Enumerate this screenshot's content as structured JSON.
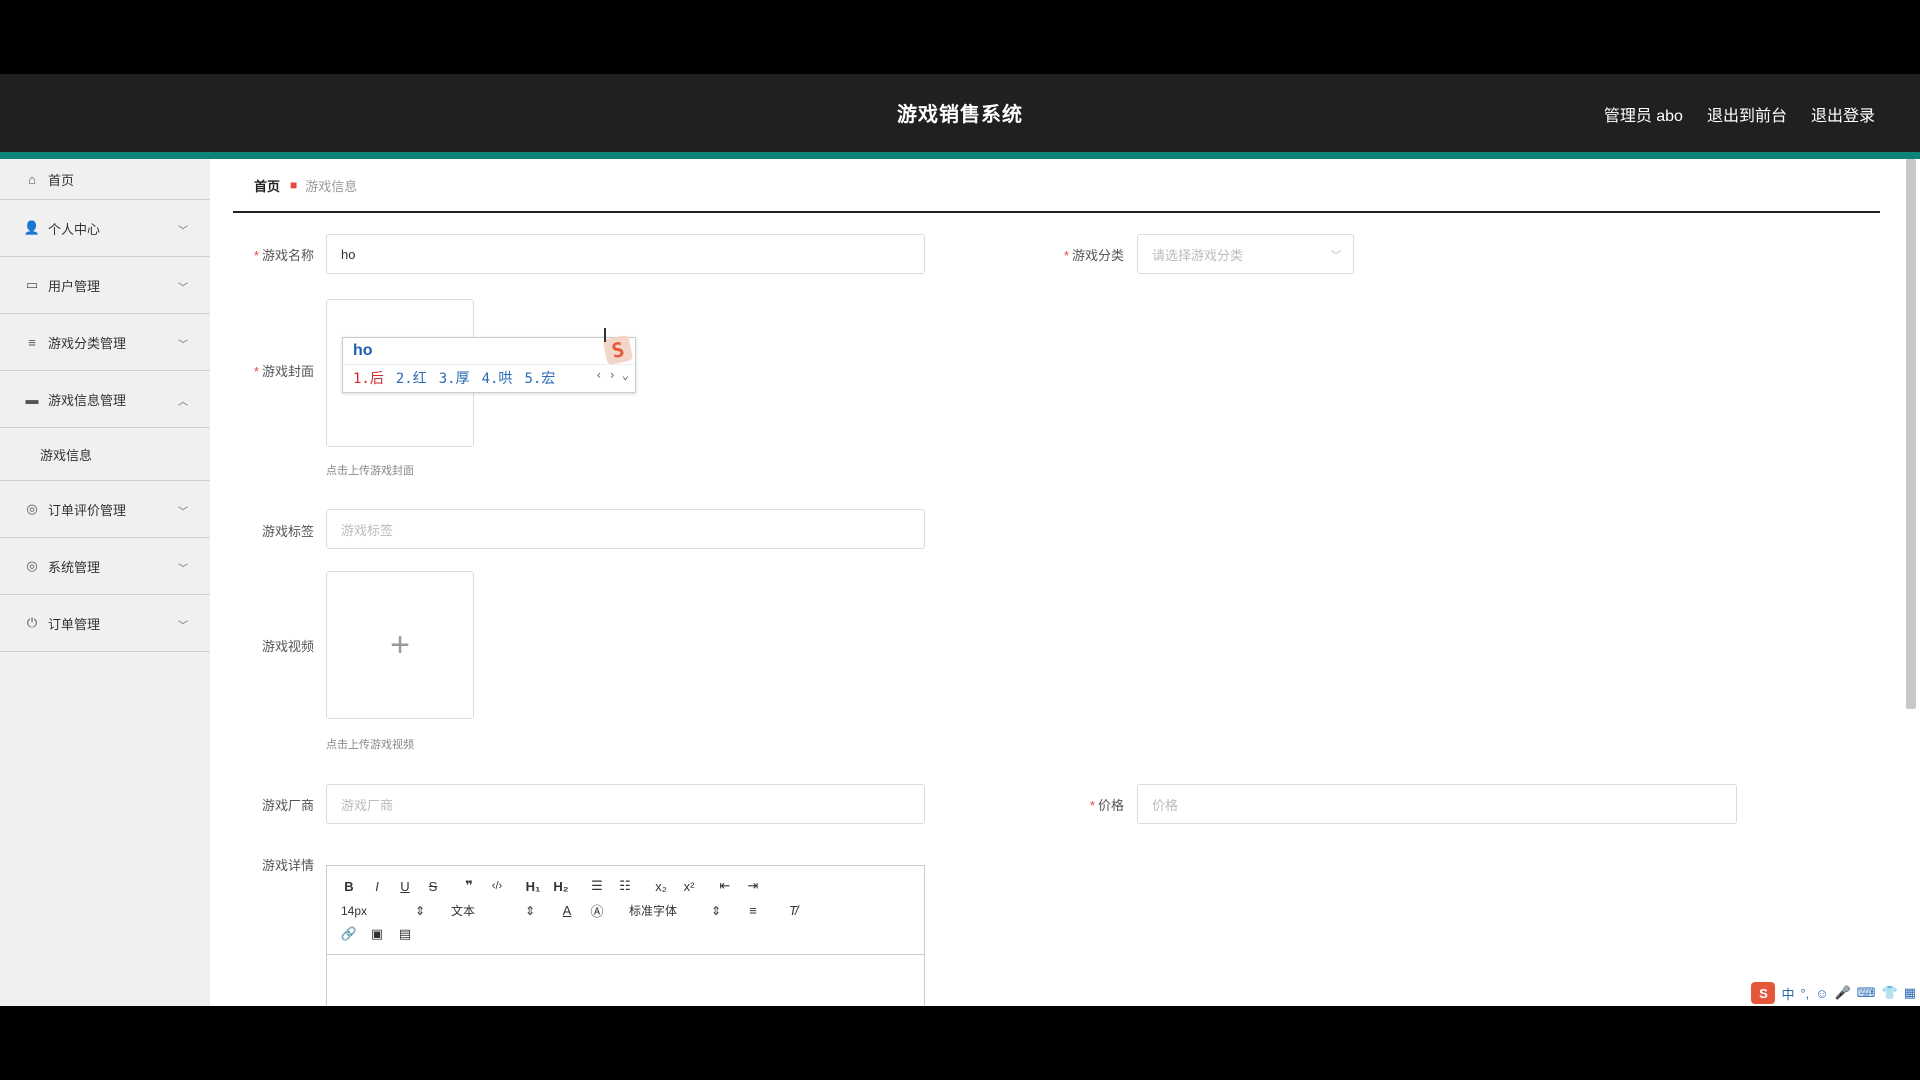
{
  "header": {
    "title": "游戏销售系统",
    "admin": "管理员 abo",
    "back_front": "退出到前台",
    "logout": "退出登录"
  },
  "sidebar": {
    "items": [
      {
        "label": "首页",
        "icon": "home-icon"
      },
      {
        "label": "个人中心",
        "icon": "user-icon"
      },
      {
        "label": "用户管理",
        "icon": "briefcase-icon"
      },
      {
        "label": "游戏分类管理",
        "icon": "list-icon"
      },
      {
        "label": "游戏信息管理",
        "icon": "message-icon"
      },
      {
        "label": "订单评价管理",
        "icon": "compass-icon"
      },
      {
        "label": "系统管理",
        "icon": "compass-icon"
      },
      {
        "label": "订单管理",
        "icon": "power-icon"
      }
    ],
    "sub_item": "游戏信息"
  },
  "breadcrumb": {
    "home": "首页",
    "current": "游戏信息"
  },
  "form": {
    "name_label": "游戏名称",
    "name_value": "ho",
    "category_label": "游戏分类",
    "category_placeholder": "请选择游戏分类",
    "cover_label": "游戏封面",
    "cover_hint": "点击上传游戏封面",
    "tags_label": "游戏标签",
    "tags_placeholder": "游戏标签",
    "video_label": "游戏视频",
    "video_hint": "点击上传游戏视频",
    "vendor_label": "游戏厂商",
    "vendor_placeholder": "游戏厂商",
    "price_label": "价格",
    "price_placeholder": "价格",
    "detail_label": "游戏详情"
  },
  "ime": {
    "composition": "ho",
    "candidates": [
      "1.后",
      "2.红",
      "3.厚",
      "4.哄",
      "5.宏"
    ],
    "logo": "S"
  },
  "editor": {
    "font_size": "14px",
    "block_type": "文本",
    "font_family": "标准字体"
  },
  "ime_bar": {
    "lang": "中",
    "punct": "°,"
  },
  "colors": {
    "topbar": "#202020",
    "accent": "#0d8479",
    "required": "#e44444"
  }
}
